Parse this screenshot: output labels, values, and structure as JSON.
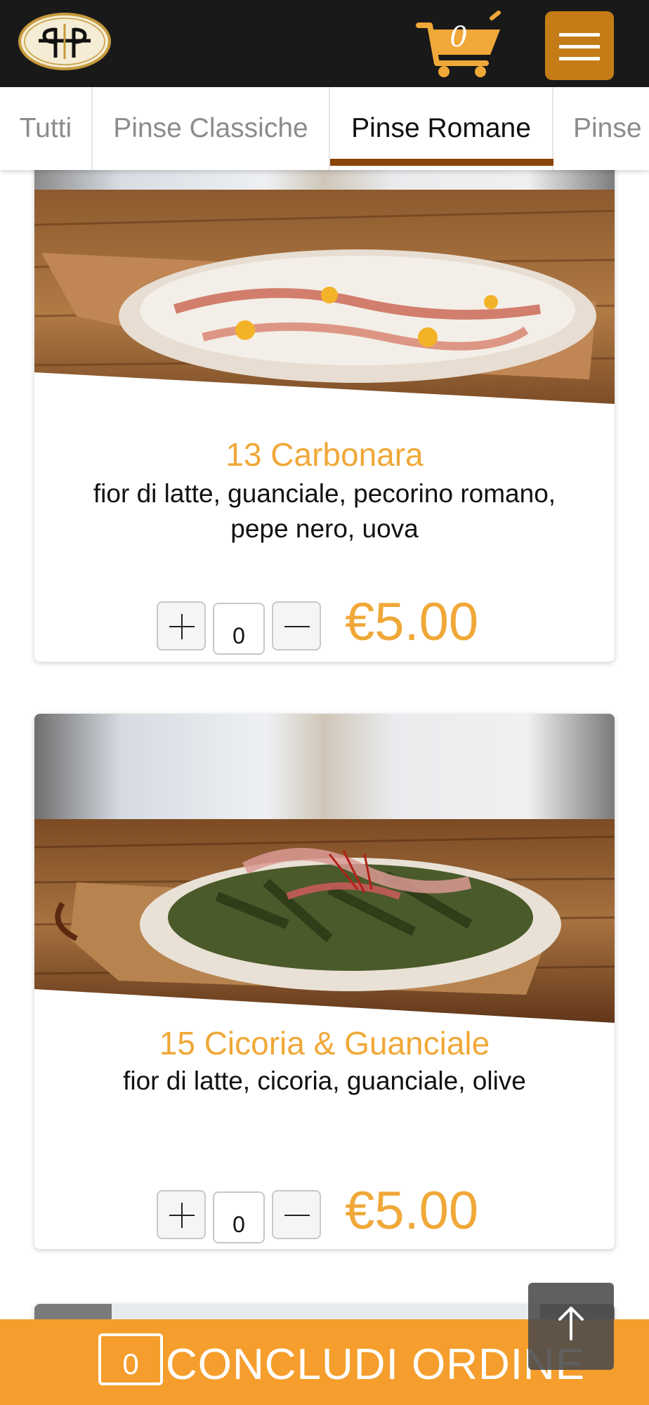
{
  "header": {
    "logo_alt": "PP",
    "cart_count": "0",
    "menu_icon": "hamburger-icon",
    "accent_color": "#c57c17"
  },
  "tabs": [
    {
      "label": "Tutti"
    },
    {
      "label": "Pinse Classiche"
    },
    {
      "label": "Pinse Romane",
      "active": true
    },
    {
      "label": "Pinse"
    }
  ],
  "products": [
    {
      "title": "13 Carbonara",
      "description": "fior di latte, guanciale, pecorino romano, pepe nero, uova",
      "quantity": "0",
      "price": "€5.00"
    },
    {
      "title": "15 Cicoria & Guanciale",
      "description": "fior di latte, cicoria, guanciale, olive",
      "quantity": "0",
      "price": "€5.00"
    }
  ],
  "order_bar": {
    "count": "0",
    "label": "CONCLUDI ORDINE",
    "color": "#f59e2d"
  },
  "scroll_top_icon": "arrow-up-icon"
}
